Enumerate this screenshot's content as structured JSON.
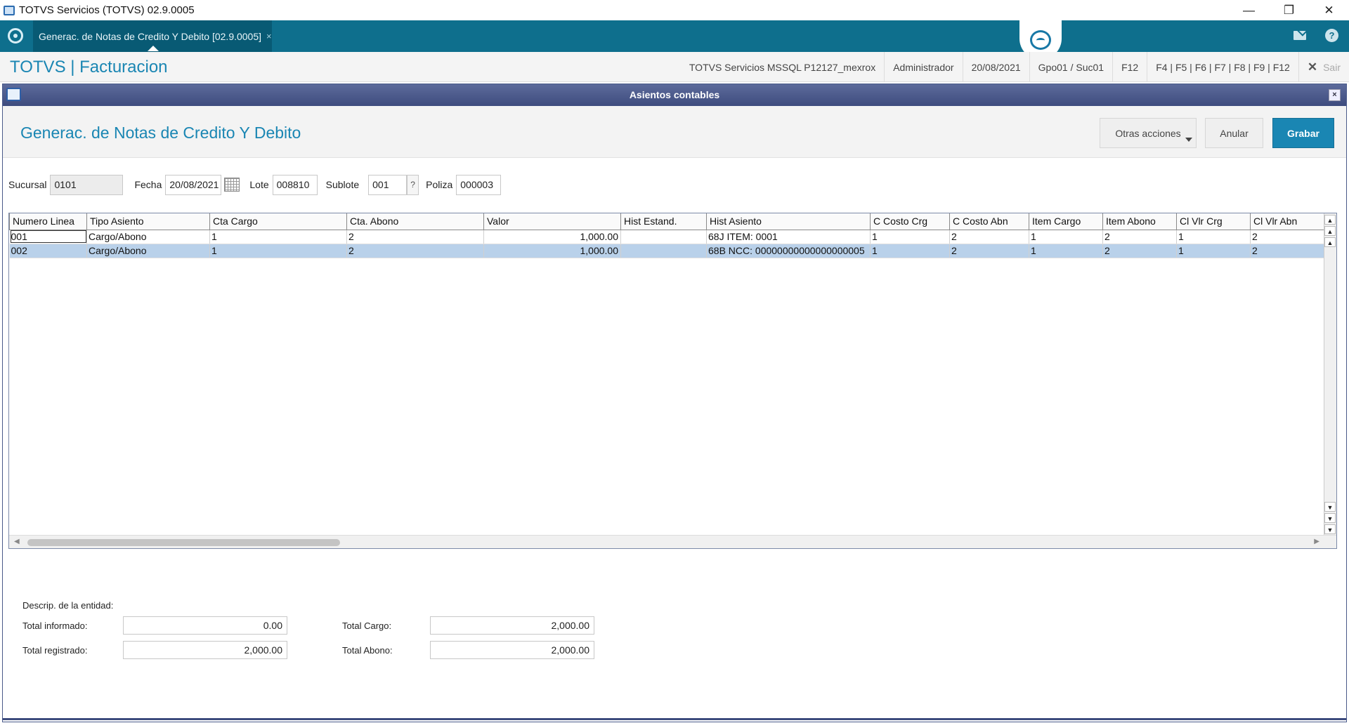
{
  "window": {
    "title": "TOTVS Servicios (TOTVS) 02.9.0005"
  },
  "os_controls": {
    "minimize": "—",
    "restore": "❐",
    "close": "✕"
  },
  "tab": {
    "label": "Generac. de Notas de Credito Y Debito [02.9.0005]",
    "close": "×"
  },
  "header": {
    "brand": "TOTVS | Facturacion",
    "server": "TOTVS Servicios MSSQL P12127_mexrox",
    "user": "Administrador",
    "date": "20/08/2021",
    "branch": "Gpo01 / Suc01",
    "f12": "F12",
    "fkeys": "F4 | F5 | F6 | F7 | F8 | F9 | F12",
    "exit_icon": "✕",
    "exit": "Sair"
  },
  "dialog": {
    "title": "Asientos contables",
    "close": "×",
    "form_title": "Generac. de Notas de Credito Y Debito",
    "buttons": {
      "other_actions": "Otras acciones",
      "cancel": "Anular",
      "save": "Grabar"
    }
  },
  "fields": {
    "sucursal_label": "Sucursal",
    "sucursal": "0101",
    "fecha_label": "Fecha",
    "fecha": "20/08/2021",
    "lote_label": "Lote",
    "lote": "008810",
    "sublote_label": "Sublote",
    "sublote": "001",
    "sublote_help": "?",
    "poliza_label": "Poliza",
    "poliza": "000003"
  },
  "grid": {
    "columns": [
      "Numero Linea",
      "Tipo Asiento",
      "Cta Cargo",
      "Cta. Abono",
      "Valor",
      "Hist Estand.",
      "Hist Asiento",
      "C Costo Crg",
      "C Costo Abn",
      "Item Cargo",
      "Item Abono",
      "Cl Vlr Crg",
      "Cl Vlr Abn"
    ],
    "rows": [
      [
        "001",
        "Cargo/Abono",
        "1",
        "2",
        "1,000.00",
        "",
        "68J ITEM: 0001",
        "1",
        "2",
        "1",
        "2",
        "1",
        "2"
      ],
      [
        "002",
        "Cargo/Abono",
        "1",
        "2",
        "1,000.00",
        "",
        "68B NCC: 00000000000000000005",
        "1",
        "2",
        "1",
        "2",
        "1",
        "2"
      ]
    ]
  },
  "footer": {
    "descrip_label": "Descrip. de la entidad:",
    "total_informado_label": "Total informado:",
    "total_informado": "0.00",
    "total_registrado_label": "Total registrado:",
    "total_registrado": "2,000.00",
    "total_cargo_label": "Total Cargo:",
    "total_cargo": "2,000.00",
    "total_abono_label": "Total Abono:",
    "total_abono": "2,000.00"
  }
}
